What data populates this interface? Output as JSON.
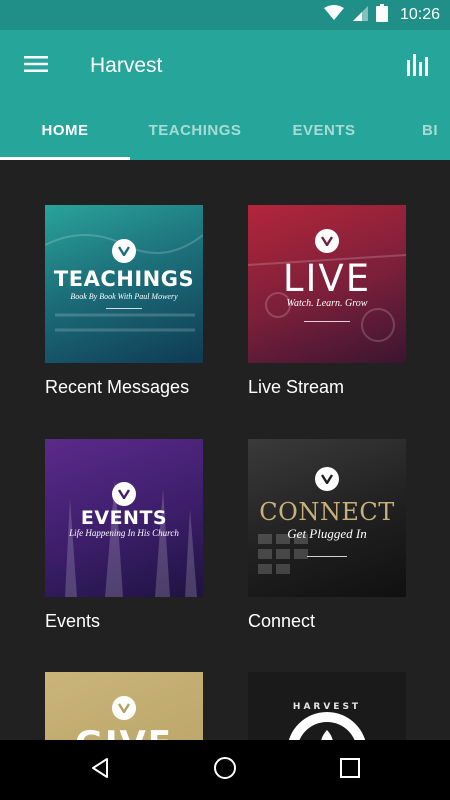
{
  "status_bar": {
    "time": "10:26"
  },
  "app_bar": {
    "title": "Harvest"
  },
  "tabs": [
    {
      "label": "HOME",
      "active": true
    },
    {
      "label": "TEACHINGS",
      "active": false
    },
    {
      "label": "EVENTS",
      "active": false
    },
    {
      "label": "BI",
      "active": false
    }
  ],
  "cards": [
    {
      "label": "Recent Messages",
      "image_title": "TEACHINGS",
      "image_subtitle": "Book By Book With Paul Mowery"
    },
    {
      "label": "Live Stream",
      "image_title": "LIVE",
      "image_subtitle": "Watch. Learn. Grow"
    },
    {
      "label": "Events",
      "image_title": "EVENTS",
      "image_subtitle": "Life Happening In His Church"
    },
    {
      "label": "Connect",
      "image_title": "CONNECT",
      "image_subtitle": "Get Plugged In"
    },
    {
      "label": "",
      "image_title": "GIVE",
      "image_subtitle": ""
    },
    {
      "label": "",
      "image_title": "HARVEST",
      "image_subtitle": ""
    }
  ],
  "colors": {
    "status_bar": "#1f8f87",
    "app_bar": "#26a69a",
    "background": "#212121",
    "connect_title": "#c9b079"
  }
}
